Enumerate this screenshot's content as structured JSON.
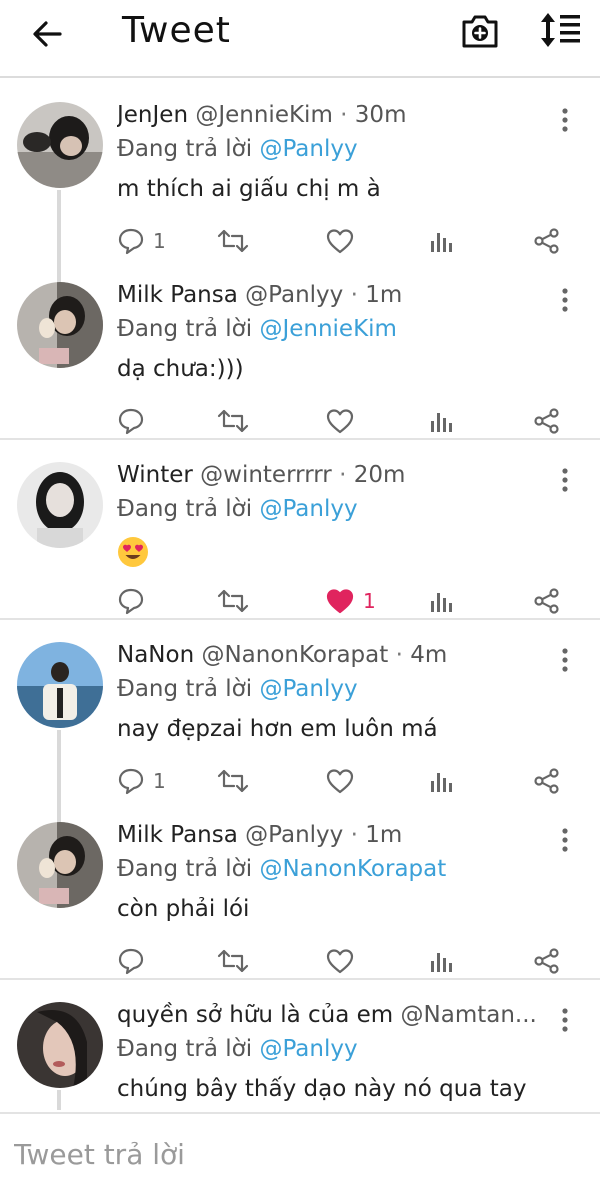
{
  "header": {
    "title": "Tweet"
  },
  "compose": {
    "placeholder": "Tweet trả lời"
  },
  "reply_prefix": "Đang trả lời",
  "tweets": [
    {
      "name": "JenJen",
      "handle": "@JennieKim",
      "dot": "·",
      "time": "30m",
      "reply_to": "@Panlyy",
      "text": "m thích ai giấu chị m à",
      "reply_count": "1",
      "like_count": "",
      "liked": false
    },
    {
      "name": "Milk Pansa",
      "handle": "@Panlyy",
      "dot": "·",
      "time": "1m",
      "reply_to": "@JennieKim",
      "text": "dạ chưa:)))",
      "reply_count": "",
      "like_count": "",
      "liked": false
    },
    {
      "name": "Winter",
      "handle": "@winterrrrr",
      "dot": "·",
      "time": "20m",
      "reply_to": "@Panlyy",
      "text": "",
      "emoji": "heart-eyes-emoji",
      "reply_count": "",
      "like_count": "1",
      "liked": true
    },
    {
      "name": "NaNon",
      "handle": "@NanonKorapat",
      "dot": "·",
      "time": "4m",
      "reply_to": "@Panlyy",
      "text": "nay đẹpzai hơn em luôn má",
      "reply_count": "1",
      "like_count": "",
      "liked": false
    },
    {
      "name": "Milk Pansa",
      "handle": "@Panlyy",
      "dot": "·",
      "time": "1m",
      "reply_to": "@NanonKorapat",
      "text": "còn phải lói",
      "reply_count": "",
      "like_count": "",
      "liked": false
    },
    {
      "name": "quyền sở hữu là của em",
      "handle": "@Namtan...",
      "dot": "",
      "time": "",
      "reply_to": "@Panlyy",
      "text": "chúng bây thấy dạo này nó qua tay",
      "reply_count": "",
      "like_count": "",
      "liked": false
    }
  ],
  "icons": {
    "back": "arrow-left-icon",
    "camera": "camera-add-icon",
    "sort": "sort-icon",
    "more": "more-vertical-icon",
    "reply": "reply-icon",
    "retweet": "retweet-icon",
    "like": "heart-icon",
    "stats": "stats-icon",
    "share": "share-icon"
  },
  "colors": {
    "mention": "#3ba0d8",
    "liked": "#e0245e",
    "icon_gray": "#666666",
    "divider": "#e3e3e3"
  }
}
